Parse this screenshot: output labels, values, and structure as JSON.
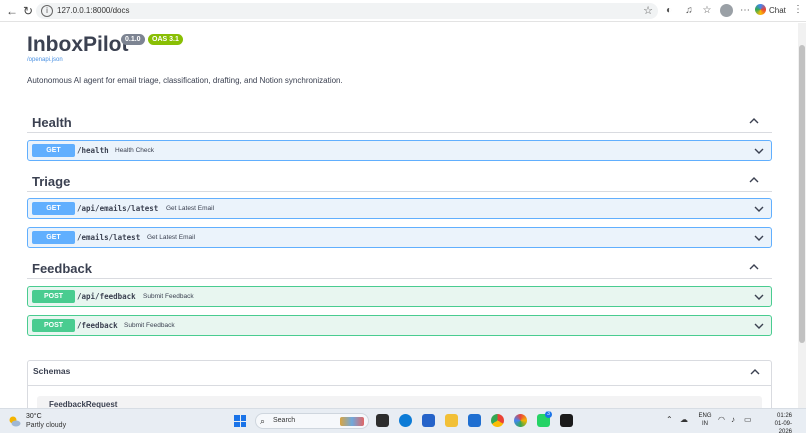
{
  "browser": {
    "url": "127.0.0.1:8000/docs",
    "chat_label": "Chat"
  },
  "api": {
    "title": "InboxPilot",
    "version": "0.1.0",
    "oas": "OAS 3.1",
    "spec_link": "/openapi.json",
    "description": "Autonomous AI agent for email triage, classification, drafting, and Notion synchronization."
  },
  "sections": [
    {
      "name": "Health",
      "operations": [
        {
          "method": "GET",
          "path": "/health",
          "summary": "Health Check"
        }
      ]
    },
    {
      "name": "Triage",
      "operations": [
        {
          "method": "GET",
          "path": "/api/emails/latest",
          "summary": "Get Latest Email"
        },
        {
          "method": "GET",
          "path": "/emails/latest",
          "summary": "Get Latest Email"
        }
      ]
    },
    {
      "name": "Feedback",
      "operations": [
        {
          "method": "POST",
          "path": "/api/feedback",
          "summary": "Submit Feedback"
        },
        {
          "method": "POST",
          "path": "/feedback",
          "summary": "Submit Feedback"
        }
      ]
    }
  ],
  "schemas": {
    "title": "Schemas",
    "first_item": "FeedbackRequest"
  },
  "colors": {
    "get": "#61affe",
    "post": "#49cc90",
    "oas_badge": "#89bf04",
    "version_badge": "#7d8492"
  },
  "taskbar": {
    "weather_temp": "30°C",
    "weather_desc": "Partly cloudy",
    "search_placeholder": "Search",
    "lang_line1": "ENG",
    "lang_line2": "IN",
    "time": "01:26",
    "date": "01-09-2026",
    "whatsapp_badge": "3"
  }
}
